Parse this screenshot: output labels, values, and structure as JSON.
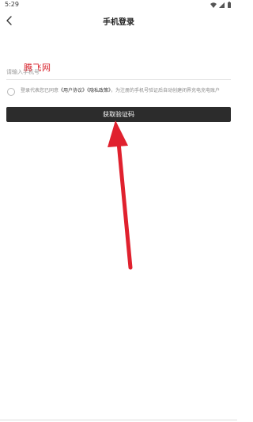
{
  "status_bar": {
    "time": "5:29",
    "icons": [
      "wifi-icon",
      "signal-icon",
      "battery-icon"
    ]
  },
  "header": {
    "title": "手机登录",
    "back_icon": "back-arrow-icon"
  },
  "watermark": {
    "text": "腾飞网",
    "color": "#d8262f"
  },
  "form": {
    "phone_placeholder": "请输入手机号",
    "phone_value": "",
    "agreement": {
      "checked": false,
      "prefix": "登录代表您已同意",
      "user_agreement": "《用户协议》",
      "privacy_policy": "《隐私政策》",
      "suffix": "，为注册的手机号验证后自动创建闭界充电充电账户"
    },
    "get_code_button": "获取验证码"
  },
  "annotation": {
    "color": "#e0212e"
  },
  "colors": {
    "button_bg": "#2c2c2c",
    "button_text": "#ffffff",
    "placeholder": "#999999"
  }
}
